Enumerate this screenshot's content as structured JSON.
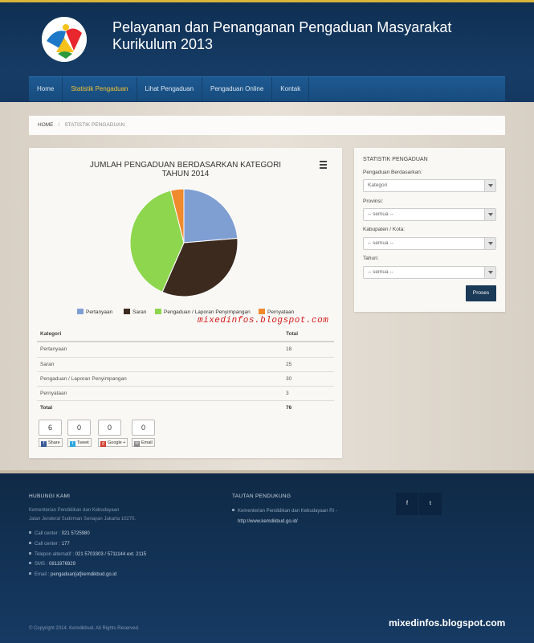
{
  "header": {
    "title": "Pelayanan dan Penanganan Pengaduan Masyarakat Kurikulum 2013"
  },
  "nav": {
    "items": [
      {
        "label": "Home",
        "active": false
      },
      {
        "label": "Statistik Pengaduan",
        "active": true
      },
      {
        "label": "Lihat Pengaduan",
        "active": false
      },
      {
        "label": "Pengaduan Online",
        "active": false
      },
      {
        "label": "Kontak",
        "active": false
      }
    ]
  },
  "breadcrumb": {
    "home": "HOME",
    "separator": "/",
    "current": "STATISTIK PENGADUAN"
  },
  "chart": {
    "title_line1": "JUMLAH PENGADUAN BERDASARKAN KATEGORI",
    "title_line2": "TAHUN 2014"
  },
  "chart_data": {
    "type": "pie",
    "title": "JUMLAH PENGADUAN BERDASARKAN KATEGORI TAHUN 2014",
    "categories": [
      "Pertanyaan",
      "Saran",
      "Pengaduan / Laporan Penyimpangan",
      "Pernyataan"
    ],
    "values": [
      18,
      25,
      30,
      3
    ],
    "colors": [
      "#7f9fd3",
      "#3d2a1f",
      "#8ed64e",
      "#f08a2c"
    ],
    "legend_placement": "bottom"
  },
  "watermark_overlay": "mixedinfos.blogspot.com",
  "table": {
    "headers": [
      "Kategori",
      "Total"
    ],
    "rows": [
      [
        "Pertanyaan",
        "18"
      ],
      [
        "Saran",
        "25"
      ],
      [
        "Pengaduan / Laporan Penyimpangan",
        "30"
      ],
      [
        "Pernyataan",
        "3"
      ]
    ],
    "total_label": "Total",
    "total_value": "76"
  },
  "share": [
    {
      "count": "6",
      "label": "Share",
      "icon": "facebook-icon",
      "color": "#3b5998",
      "glyph": "f"
    },
    {
      "count": "0",
      "label": "Tweet",
      "icon": "twitter-icon",
      "color": "#2ea7e0",
      "glyph": "t"
    },
    {
      "count": "0",
      "label": "Google +",
      "icon": "google-plus-icon",
      "color": "#d23f31",
      "glyph": "g"
    },
    {
      "count": "0",
      "label": "Email",
      "icon": "email-icon",
      "color": "#888888",
      "glyph": "✉"
    }
  ],
  "sidebar": {
    "title": "STATISTIK PENGADUAN",
    "fields": [
      {
        "label": "Pengaduan Berdasarkan:",
        "value": "Kategori"
      },
      {
        "label": "Provinsi:",
        "value": "-- semua --"
      },
      {
        "label": "Kabupaten / Kota:",
        "value": "-- semua --"
      },
      {
        "label": "Tahun:",
        "value": "-- semua --"
      }
    ],
    "submit_label": "Proses"
  },
  "footer": {
    "contact_heading": "HUBUNGI KAMI",
    "address_line1": "Kementerian Pendidikan dan Kebudayaan",
    "address_line2": "Jalan Jenderal Sudirman Senayan Jakarta 10270.",
    "contacts": [
      {
        "label": "Call center : ",
        "value": "021 5725980",
        "icon": "phone-icon"
      },
      {
        "label": "Call center : ",
        "value": "177",
        "icon": "phone-icon"
      },
      {
        "label": "Telepon alternatif : ",
        "value": "021 5703303 / 5711144 ext. 2115",
        "icon": "phone-icon"
      },
      {
        "label": "SMS : ",
        "value": "0811976929",
        "icon": "sms-icon"
      },
      {
        "label": "Email : ",
        "value": "pengaduan[at]kemdikbud.go.id",
        "icon": "email-icon"
      }
    ],
    "links_heading": "TAUTAN PENDUKUNG",
    "link_text": "Kementerian Pendidikan dan Kebudayaan RI -",
    "link_url": "http://www.kemdikbud.go.id/",
    "social": [
      {
        "label": "f",
        "icon": "facebook-icon"
      },
      {
        "label": "t",
        "icon": "twitter-icon"
      }
    ],
    "copyright": "© Copyright 2014. Kemdikbud. All Rights Reserved.",
    "site_watermark": "mixedinfos.blogspot.com"
  }
}
